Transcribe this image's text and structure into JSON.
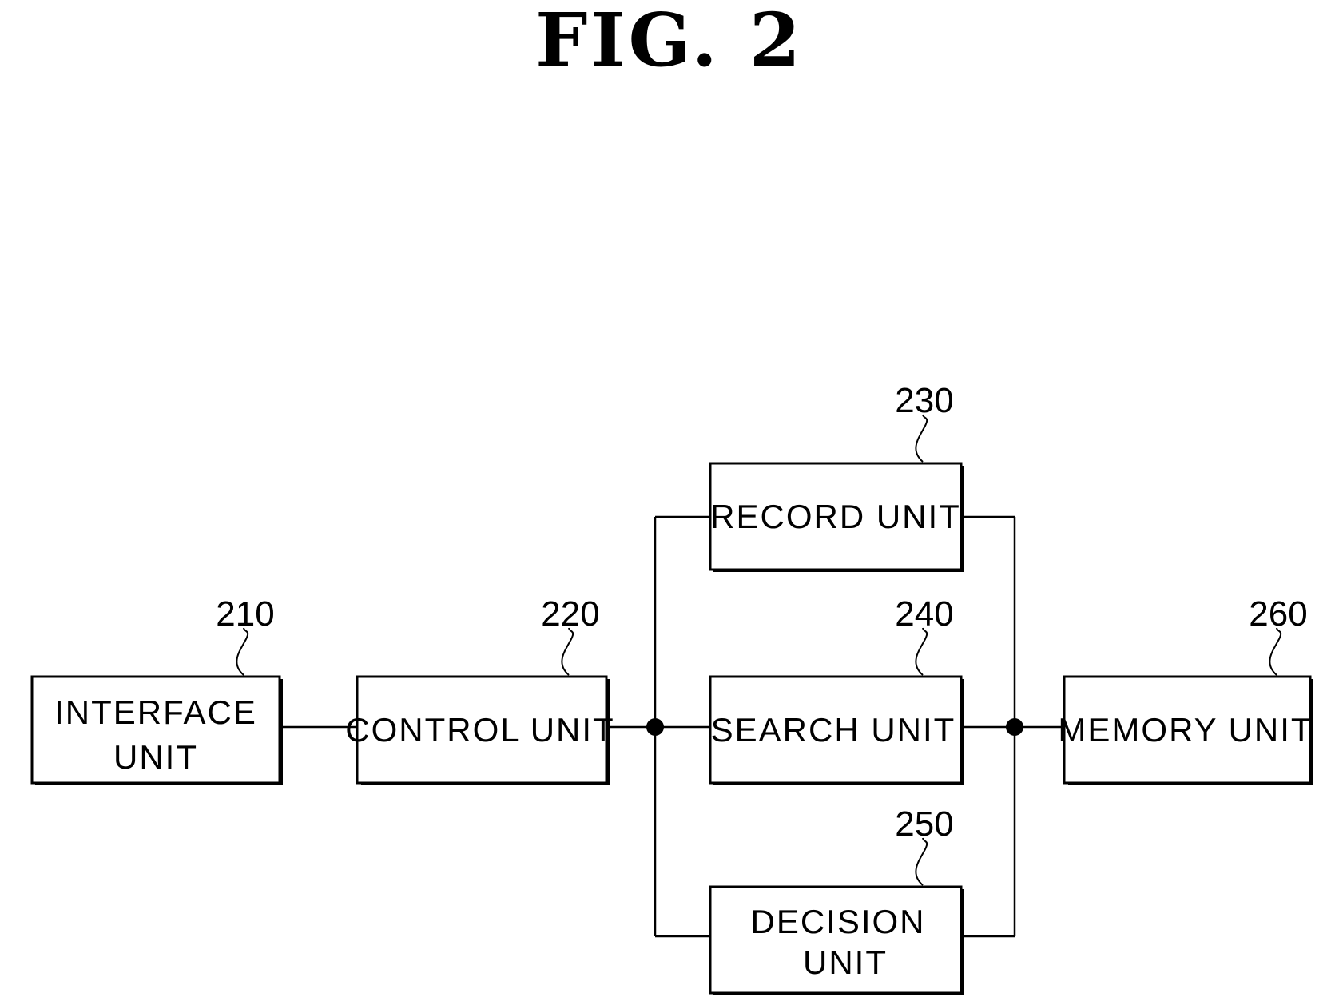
{
  "figure": {
    "title": "FIG. 2"
  },
  "blocks": [
    {
      "id": "interface",
      "ref": "210",
      "lines": [
        "INTERFACE",
        "UNIT"
      ]
    },
    {
      "id": "control",
      "ref": "220",
      "lines": [
        "CONTROL UNIT"
      ]
    },
    {
      "id": "record",
      "ref": "230",
      "lines": [
        "RECORD UNIT"
      ]
    },
    {
      "id": "search",
      "ref": "240",
      "lines": [
        "SEARCH UNIT"
      ]
    },
    {
      "id": "decision",
      "ref": "250",
      "lines": [
        "DECISION",
        "UNIT"
      ]
    },
    {
      "id": "memory",
      "ref": "260",
      "lines": [
        "MEMORY UNIT"
      ]
    }
  ],
  "connections": [
    [
      "interface",
      "control"
    ],
    [
      "control",
      "junction-left"
    ],
    [
      "junction-left",
      "record"
    ],
    [
      "junction-left",
      "search"
    ],
    [
      "junction-left",
      "decision"
    ],
    [
      "record",
      "junction-right"
    ],
    [
      "search",
      "junction-right"
    ],
    [
      "decision",
      "junction-right"
    ],
    [
      "junction-right",
      "memory"
    ]
  ]
}
